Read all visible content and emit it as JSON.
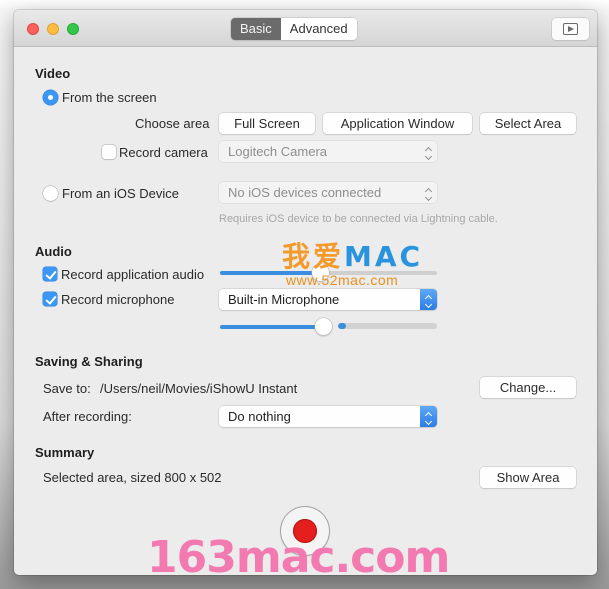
{
  "window": {
    "tabs": [
      {
        "label": "Basic",
        "selected": true
      },
      {
        "label": "Advanced",
        "selected": false
      }
    ],
    "preview_icon": "play-preview-icon"
  },
  "video": {
    "title": "Video",
    "from_screen": {
      "label": "From the screen",
      "selected": true
    },
    "choose_area_label": "Choose area",
    "area_buttons": [
      "Full Screen",
      "Application Window",
      "Select Area"
    ],
    "record_camera": {
      "label": "Record camera",
      "checked": false
    },
    "camera_select": {
      "value": "Logitech Camera",
      "enabled": false
    },
    "from_ios": {
      "label": "From an iOS Device",
      "selected": false
    },
    "ios_select": {
      "value": "No iOS devices connected",
      "enabled": false
    },
    "ios_hint": "Requires iOS device to be connected via Lightning cable."
  },
  "audio": {
    "title": "Audio",
    "record_app_audio": {
      "label": "Record application audio",
      "checked": true,
      "volume_percent": 46
    },
    "record_microphone": {
      "label": "Record microphone",
      "checked": true
    },
    "microphone_select": {
      "value": "Built-in Microphone"
    },
    "mic_volume_percent": 92,
    "mic_level_percent": 5
  },
  "saving": {
    "title": "Saving & Sharing",
    "save_to_label": "Save to:",
    "save_to_path": "/Users/neil/Movies/iShowU Instant",
    "change_button": "Change...",
    "after_recording_label": "After recording:",
    "after_recording_select": {
      "value": "Do nothing"
    }
  },
  "summary": {
    "title": "Summary",
    "text": "Selected area, sized 800 x 502",
    "show_area_button": "Show Area"
  },
  "record_button": {
    "icon": "record-icon"
  },
  "watermarks": {
    "cn": "我爱",
    "en": "MAC",
    "url": "www.52mac.com",
    "bottom": "163mac.com"
  },
  "colors": {
    "accent": "#3b97f3",
    "record": "#e51e1e",
    "segment_selected": "#6b6b6b"
  }
}
